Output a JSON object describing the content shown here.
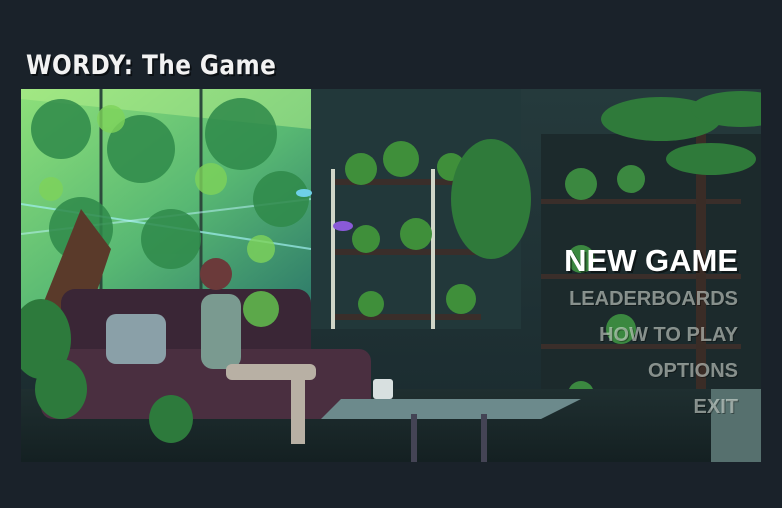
{
  "game": {
    "title": "WORDY: The Game"
  },
  "menu": {
    "items": [
      {
        "label": "NEW GAME"
      },
      {
        "label": "LEADERBOARDS"
      },
      {
        "label": "HOW TO PLAY"
      },
      {
        "label": "OPTIONS"
      },
      {
        "label": "EXIT"
      }
    ]
  },
  "colors": {
    "background": "#1a222a",
    "title": "#f2f2f2",
    "menu_primary": "#ffffff",
    "menu_secondary": "#c9d1c9"
  }
}
